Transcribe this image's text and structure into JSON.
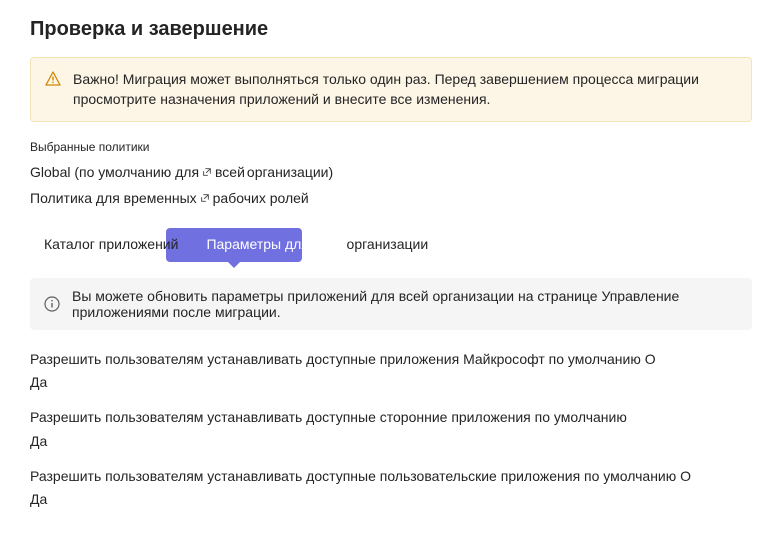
{
  "title": "Проверка и завершение",
  "warning": {
    "text": "Важно! Миграция может выполняться только один раз. Перед завершением процесса миграции просмотрите назначения приложений и внесите все изменения."
  },
  "policies_section_label": "Выбранные политики",
  "policies": [
    {
      "prefix": "Global (по умолчанию для ",
      "link_suffix": "всей",
      "suffix": " организации)"
    },
    {
      "prefix": "Политика для временных",
      "link_suffix": "",
      "suffix": "рабочих ролей"
    }
  ],
  "tabs": [
    {
      "label": "Каталог приложений"
    },
    {
      "label_pre": "Параметры для всей",
      "label_post": " организации"
    }
  ],
  "info": {
    "text": "Вы можете обновить параметры приложений для всей организации на странице Управление приложениями после миграции."
  },
  "settings": [
    {
      "label": "Разрешить пользователям устанавливать доступные приложения Майкрософт по умолчанию О",
      "value": "Да"
    },
    {
      "label": "Разрешить пользователям устанавливать доступные сторонние приложения по умолчанию",
      "value": "Да"
    },
    {
      "label": "Разрешить пользователям устанавливать доступные пользовательские приложения по умолчанию О",
      "value": "Да"
    }
  ]
}
